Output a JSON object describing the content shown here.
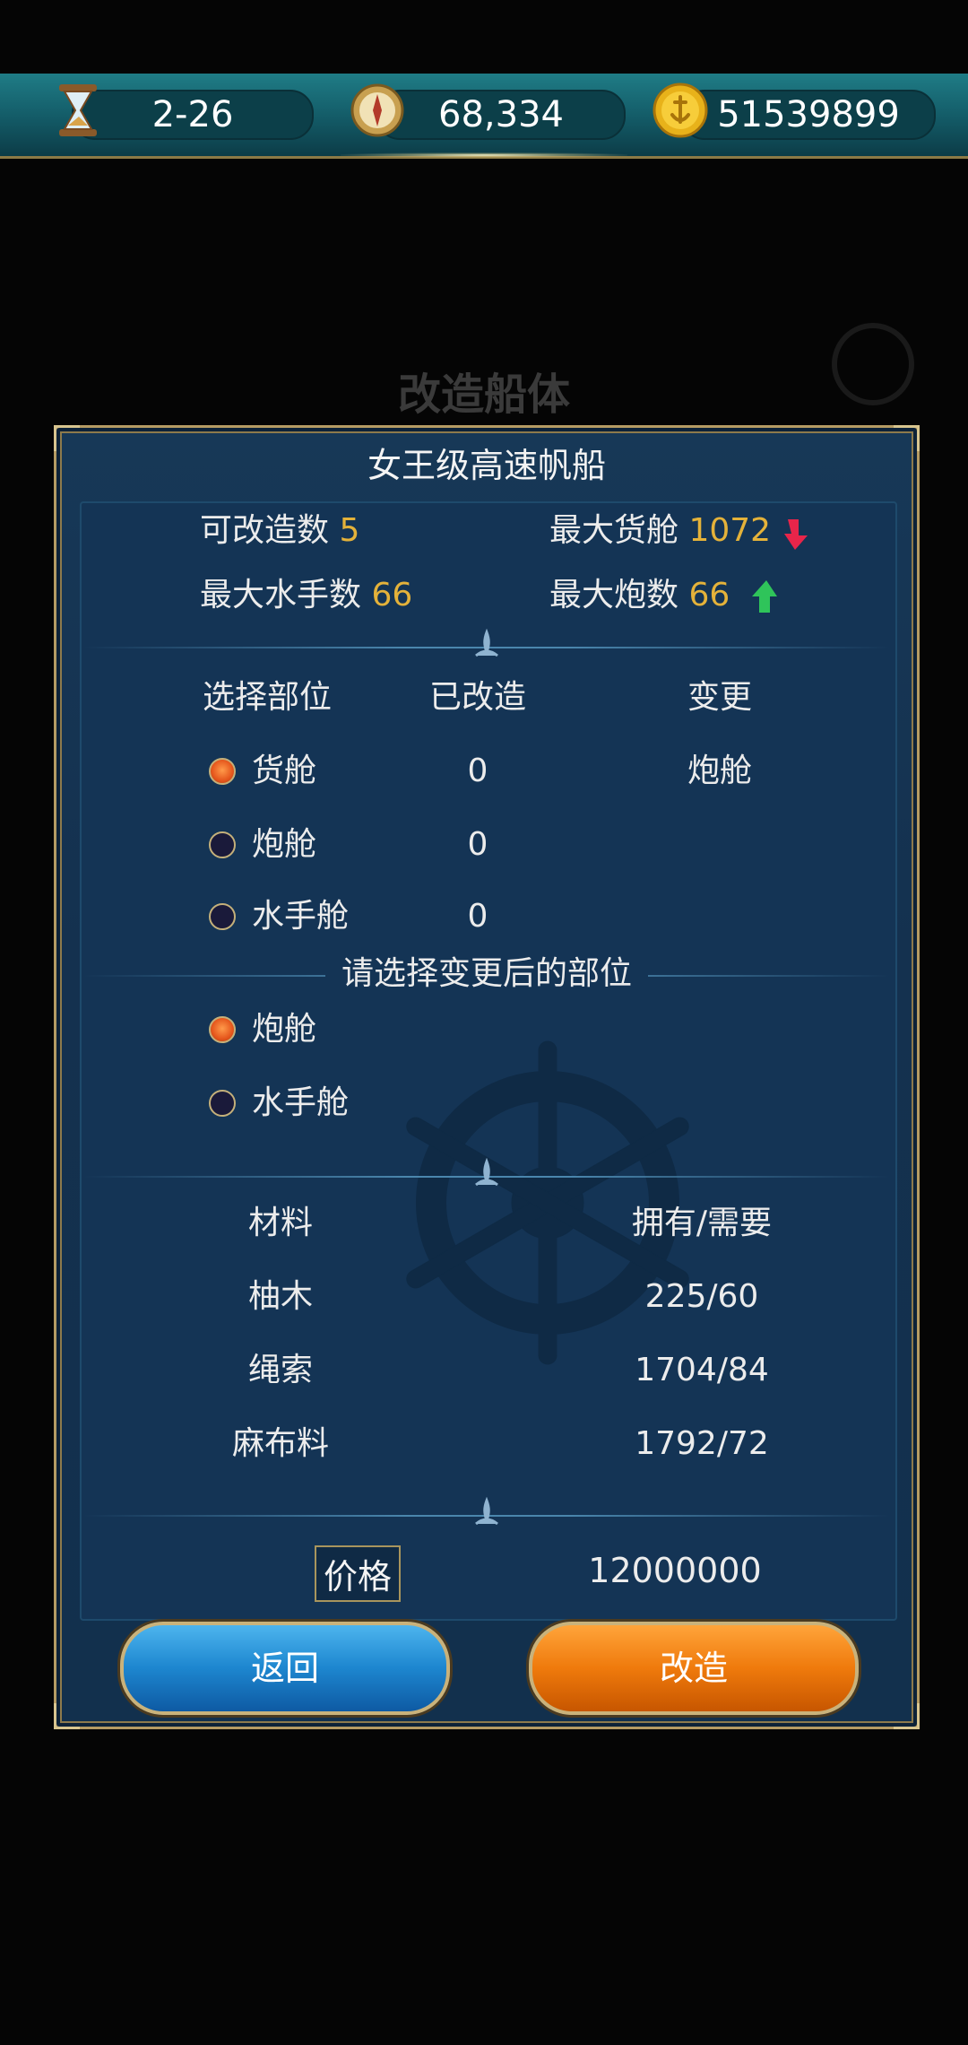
{
  "topbar": {
    "date": "2-26",
    "compass_value": "68,334",
    "gold_value": "51539899",
    "icons": [
      "hourglass-icon",
      "compass-icon",
      "gold-coin-icon"
    ]
  },
  "background": {
    "title": "改造船体"
  },
  "dialog": {
    "title": "女王级高速帆船",
    "stats": {
      "modifiable_label": "可改造数",
      "modifiable_value": "5",
      "max_cargo_label": "最大货舱",
      "max_cargo_value": "1072",
      "max_sailors_label": "最大水手数",
      "max_sailors_value": "66",
      "max_cannons_label": "最大炮数",
      "max_cannons_value": "66",
      "cargo_trend": "down",
      "cannons_trend": "up"
    },
    "parts_table": {
      "headers": [
        "选择部位",
        "已改造",
        "变更"
      ],
      "rows": [
        {
          "part": "货舱",
          "modified": "0",
          "change": "炮舱",
          "selected": true
        },
        {
          "part": "炮舱",
          "modified": "0",
          "change": "",
          "selected": false
        },
        {
          "part": "水手舱",
          "modified": "0",
          "change": "",
          "selected": false
        }
      ]
    },
    "after_prompt": "请选择变更后的部位",
    "after_options": [
      {
        "label": "炮舱",
        "selected": true
      },
      {
        "label": "水手舱",
        "selected": false
      }
    ],
    "materials": {
      "headers": [
        "材料",
        "拥有/需要"
      ],
      "rows": [
        {
          "name": "柚木",
          "amount": "225/60"
        },
        {
          "name": "绳索",
          "amount": "1704/84"
        },
        {
          "name": "麻布料",
          "amount": "1792/72"
        }
      ]
    },
    "price_label": "价格",
    "price_value": "12000000",
    "back_label": "返回",
    "modify_label": "改造"
  },
  "colors": {
    "accent_yellow": "#e4b23a",
    "down_red": "#e8254a",
    "up_green": "#2fc45a",
    "button_blue": "#1d86cf",
    "button_orange": "#ef7a0c"
  }
}
